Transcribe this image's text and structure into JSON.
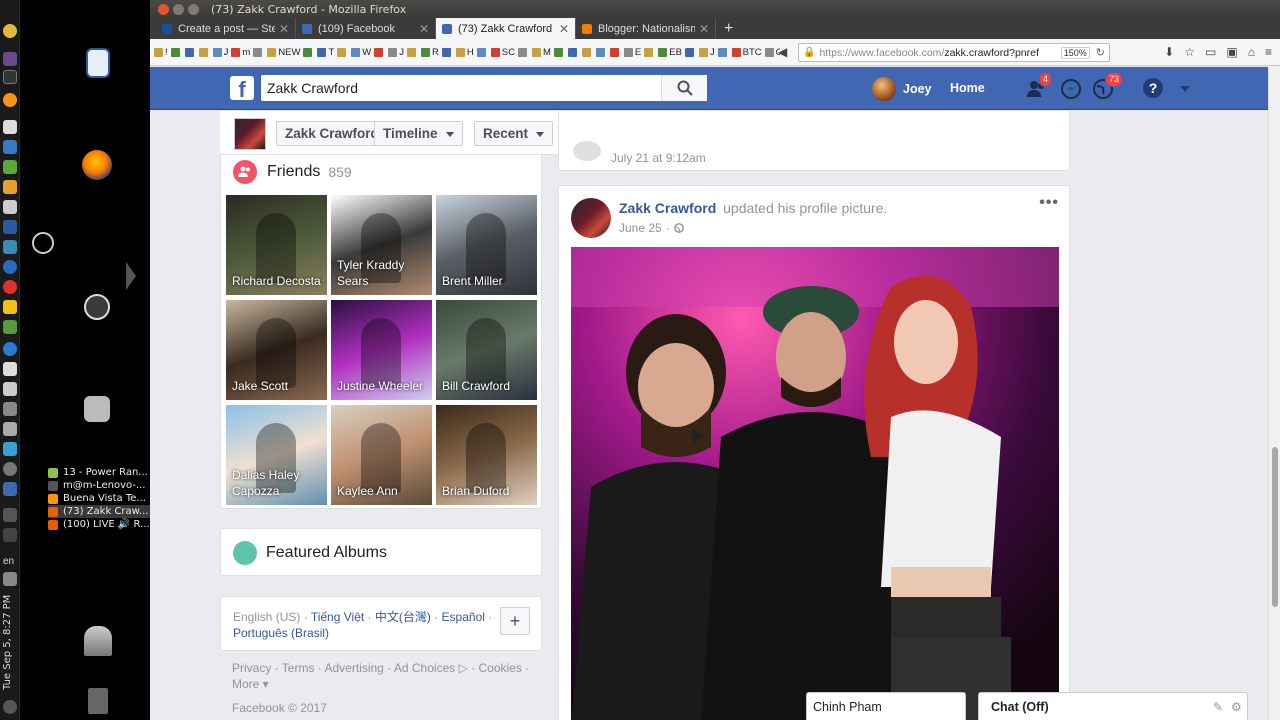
{
  "system": {
    "clock": "Tue Sep 5, 8:27 PM",
    "language": "en",
    "taskbar_windows": [
      {
        "label": "13 - Power Ran...",
        "color": "#8bc34a"
      },
      {
        "label": "m@m-Lenovo-...",
        "color": "#555555"
      },
      {
        "label": "Buena Vista Te...",
        "color": "#ff9800"
      },
      {
        "label": "(73) Zakk Craw...",
        "color": "#e66000"
      },
      {
        "label": "(100) LIVE 🔊 R...",
        "color": "#e66000"
      }
    ]
  },
  "browser": {
    "window_title": "(73) Zakk Crawford - Mozilla Firefox",
    "tabs": [
      {
        "label": "Create a post — Steem",
        "icon_color": "#1a5099",
        "active": false
      },
      {
        "label": "(109) Facebook",
        "icon_color": "#4267b2",
        "active": false
      },
      {
        "label": "(73) Zakk Crawford",
        "icon_color": "#4267b2",
        "active": true
      },
      {
        "label": "Blogger: Nationalism",
        "icon_color": "#f57d00",
        "active": false
      }
    ],
    "new_tab_icon": "+",
    "bookmarks": [
      "!",
      "",
      "",
      "",
      "J",
      "m",
      "",
      "NEW",
      "",
      "T",
      "",
      "W",
      "",
      "J",
      "",
      "R",
      "",
      "H",
      "",
      "SC",
      "",
      "M",
      "",
      "",
      "",
      "",
      "",
      "E",
      "",
      "EB",
      "",
      "J",
      "",
      "BTC",
      "G",
      "",
      "",
      "G",
      "WOW"
    ],
    "url_host": "https://www.facebook.com/",
    "url_path": "zakk.crawford?pnref",
    "zoom_level": "150%"
  },
  "facebook": {
    "logo": "f",
    "search_value": "Zakk Crawford",
    "user_name": "Joey",
    "home_label": "Home",
    "friend_requests_badge": "4",
    "notifications_badge": "73",
    "help_label": "?",
    "profile_nav": {
      "name": "Zakk Crawford",
      "timeline_label": "Timeline",
      "recent_label": "Recent"
    },
    "friends": {
      "title": "Friends",
      "count": "859",
      "items": [
        {
          "name": "Richard Decosta",
          "colors": [
            "#2b2a22",
            "#4c5a3a",
            "#8a7f60"
          ]
        },
        {
          "name": "Tyler Kraddy Sears",
          "colors": [
            "#ffffff",
            "#3a3a3a",
            "#b08a70"
          ]
        },
        {
          "name": "Brent Miller",
          "colors": [
            "#c9d4de",
            "#5a5f66",
            "#2f3338"
          ]
        },
        {
          "name": "Jake Scott",
          "colors": [
            "#c8b8a0",
            "#3a2a20",
            "#8a6a50"
          ]
        },
        {
          "name": "Justine Wheeler",
          "colors": [
            "#2a1040",
            "#b030c0",
            "#d0d0f0"
          ]
        },
        {
          "name": "Bill Crawford",
          "colors": [
            "#3a4a3a",
            "#6a7a6a",
            "#2a3040"
          ]
        },
        {
          "name": "Dallas Haley Capozza",
          "colors": [
            "#8ac0e8",
            "#f0e0d0",
            "#6090b0"
          ]
        },
        {
          "name": "Kaylee Ann",
          "colors": [
            "#d8d0c0",
            "#c09070",
            "#5a4a3a"
          ]
        },
        {
          "name": "Brian Duford",
          "colors": [
            "#3a2a1a",
            "#8a6a4a",
            "#e0d0c0"
          ]
        }
      ]
    },
    "featured_albums_title": "Featured Albums",
    "languages": {
      "current": "English (US)",
      "links": [
        "Tiếng Việt",
        "中文(台灣)",
        "Español",
        "Português (Brasil)"
      ]
    },
    "footer_links": [
      "Privacy",
      "Terms",
      "Advertising",
      "Ad Choices",
      "Cookies"
    ],
    "footer_more": "More",
    "copyright": "Facebook © 2017",
    "previous_post_time": "July 21 at 9:12am",
    "post": {
      "author": "Zakk Crawford",
      "action": "updated his profile picture.",
      "date": "June 25",
      "more_icon": "•••"
    },
    "chat": {
      "open_conversation": "Chinh Pham",
      "status_label": "Chat (Off)"
    }
  },
  "colors": {
    "facebook_blue": "#4267b2",
    "link_blue": "#365899",
    "badge_red": "#fa3e3e",
    "friends_icon": "#f35369",
    "albums_icon": "#5ec3a8"
  }
}
